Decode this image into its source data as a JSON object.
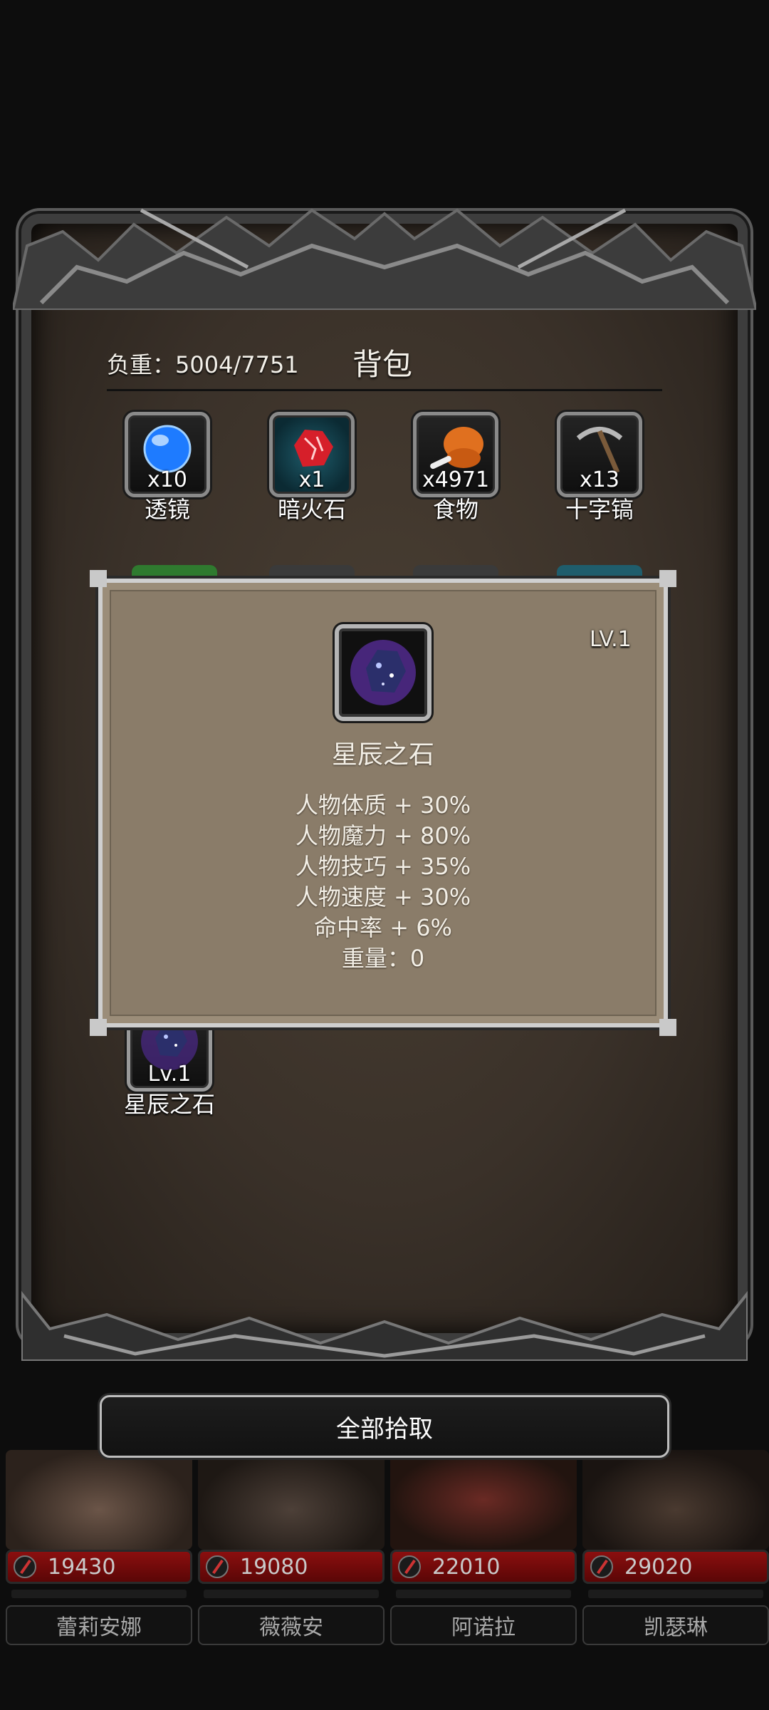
{
  "backpack": {
    "title": "背包",
    "weight_label": "负重：5004/7751"
  },
  "items": [
    {
      "name": "透镜",
      "qty": "x10",
      "icon": "lens-orb-icon",
      "color": "#1e7bff"
    },
    {
      "name": "暗火石",
      "qty": "x1",
      "icon": "dark-fire-stone-icon",
      "color": "#e02a2a"
    },
    {
      "name": "食物",
      "qty": "x4971",
      "icon": "meat-leg-icon",
      "color": "#e0701f"
    },
    {
      "name": "十字镐",
      "qty": "x13",
      "icon": "pickaxe-icon",
      "color": "#9a9a9a"
    }
  ],
  "bottom_item": {
    "name": "星辰之石",
    "qty": "Lv.1",
    "icon": "star-stone-icon"
  },
  "popup": {
    "level": "LV.1",
    "name": "星辰之石",
    "icon": "star-stone-icon",
    "stats": [
      "人物体质 + 30%",
      "人物魔力 + 80%",
      "人物技巧 + 35%",
      "人物速度 + 30%",
      "命中率 + 6%",
      "重量：0"
    ]
  },
  "collect_all_label": "全部拾取",
  "characters": [
    {
      "name": "蕾莉安娜",
      "power": "19430"
    },
    {
      "name": "薇薇安",
      "power": "19080"
    },
    {
      "name": "阿诺拉",
      "power": "22010"
    },
    {
      "name": "凯瑟琳",
      "power": "29020"
    }
  ]
}
